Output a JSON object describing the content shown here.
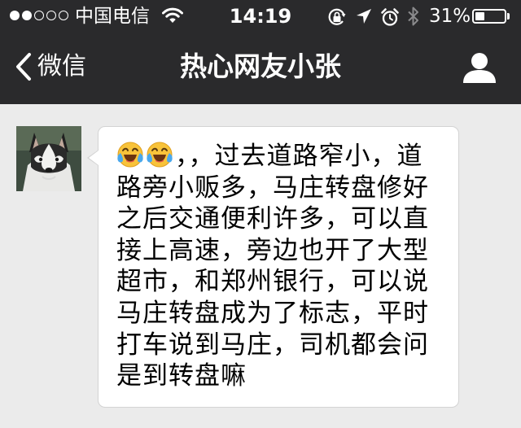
{
  "status_bar": {
    "signal_dots": [
      true,
      true,
      false,
      false,
      false
    ],
    "carrier": "中国电信",
    "time": "14:19",
    "battery_percent_label": "31%",
    "battery_level": 0.31,
    "icons": [
      "wifi-icon",
      "orientation-lock-icon",
      "location-arrow-icon",
      "alarm-icon",
      "bluetooth-icon"
    ]
  },
  "nav": {
    "back_label": "微信",
    "title": "热心网友小张",
    "right_icon": "person-icon"
  },
  "colors": {
    "nav_background": "#2a2a2c",
    "chat_background": "#ebebeb",
    "bubble_background": "#ffffff",
    "bubble_border": "#d3d3d3"
  },
  "message": {
    "sender_avatar": "husky-dog-avatar",
    "emojis": [
      "laughing-crying-emoji",
      "laughing-crying-emoji"
    ],
    "text": "，，过去道路窄小，道路旁小贩多，马庄转盘修好之后交通便利许多，可以直接上高速，旁边也开了大型超市，和郑州银行，可以说马庄转盘成为了标志，平时打车说到马庄，司机都会问是到转盘嘛"
  }
}
